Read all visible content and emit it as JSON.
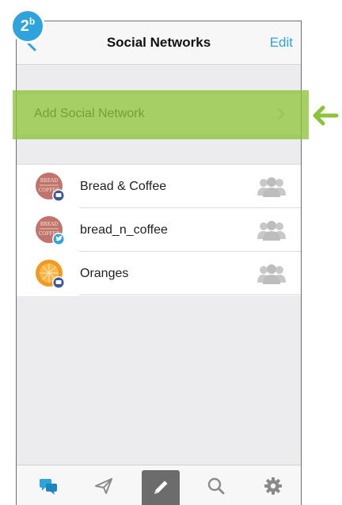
{
  "step_badge": {
    "number": "2",
    "letter": "b"
  },
  "navbar": {
    "title": "Social Networks",
    "edit_label": "Edit"
  },
  "add_row": {
    "label": "Add Social Network"
  },
  "networks": [
    {
      "label": "Bread & Coffee",
      "service": "facebook"
    },
    {
      "label": "bread_n_coffee",
      "service": "twitter"
    },
    {
      "label": "Oranges",
      "service": "facebook"
    }
  ],
  "tabs": [
    {
      "name": "messages",
      "icon": "chat-bubbles-icon"
    },
    {
      "name": "send",
      "icon": "paper-plane-icon"
    },
    {
      "name": "compose",
      "icon": "pencil-icon",
      "active": true
    },
    {
      "name": "search",
      "icon": "search-icon"
    },
    {
      "name": "settings",
      "icon": "gear-icon"
    }
  ],
  "colors": {
    "accent": "#2ea3dc",
    "highlight": "#8dc23b",
    "facebook": "#3b5998",
    "twitter": "#2ea3dc"
  }
}
